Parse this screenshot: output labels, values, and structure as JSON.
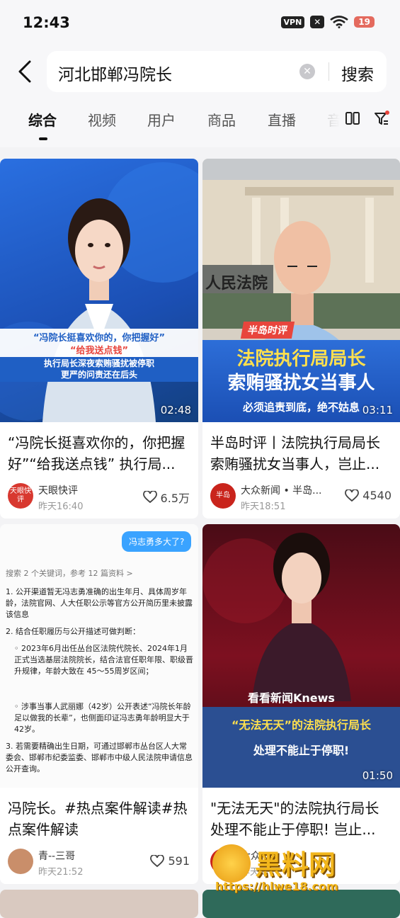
{
  "status_bar": {
    "time": "12:43",
    "vpn": "VPN",
    "battery": "19"
  },
  "search": {
    "query": "河北邯郸冯院长",
    "button": "搜索"
  },
  "tabs": [
    {
      "label": "综合",
      "active": true
    },
    {
      "label": "视频"
    },
    {
      "label": "用户"
    },
    {
      "label": "商品"
    },
    {
      "label": "直播"
    },
    {
      "label": "音"
    }
  ],
  "icons": {
    "back": "chevron-left-icon",
    "clear": "clear-icon",
    "layout": "grid-layout-icon",
    "filter": "filter-icon",
    "like": "heart-icon"
  },
  "colors": {
    "accent": "#e8453c",
    "news_blue": "#1f5fc4",
    "highlight_yellow": "#ffe04d"
  },
  "results": [
    {
      "duration": "02:48",
      "thumb_text": [
        "“冯院长挺喜欢你的，你把握好”",
        "“给我送点钱”",
        "执行局长深夜索贿骚扰被停职",
        "更严的问责还在后头"
      ],
      "title": "“冯院长挺喜欢你的，你把握好”“给我送点钱” 执行局...",
      "author": "天眼快评",
      "avatar_text": "天眼快评",
      "time": "昨天16:40",
      "likes": "6.5万"
    },
    {
      "duration": "03:11",
      "thumb_text": [
        "人民法院",
        "半岛时评",
        "法院执行局局长",
        "索贿骚扰女当事人",
        "必须追责到底，绝不姑息"
      ],
      "title": "半岛时评丨法院执行局局长索贿骚扰女当事人，岂止...",
      "author": "大众新闻 • 半岛...",
      "avatar_text": "半岛",
      "time": "昨天18:51",
      "likes": "4540"
    },
    {
      "thumb_text": [
        "冯志勇多大了?",
        "搜索 2 个关键词，参考 12 篇资料 >",
        "1. 公开渠道暂无冯志勇准确的出生年月、具体周岁年龄，法院官网、人大任职公示等官方公开简历里未披露该信息",
        "2. 结合任职履历与公开描述可做判断：",
        "◦ 2023年6月出任丛台区法院代院长、2024年1月正式当选基层法院院长，结合法官任职年限、职级晋升规律，年龄大致在 45～55周岁区间；",
        "◦ 涉事当事人武丽娜（42岁）公开表述“冯院长年龄足以做我的长辈”，也侧面印证冯志勇年龄明显大于42岁。",
        "3. 若需要精确出生日期，可通过邯郸市丛台区人大常委会、邯郸市纪委监委、邯郸市中级人民法院申请信息公开查询。"
      ],
      "title": "冯院长。#热点案件解读#热点案件解读",
      "author": "青--三哥",
      "time": "昨天21:52",
      "likes": "591"
    },
    {
      "duration": "01:50",
      "thumb_text": [
        "看看新闻Knews",
        "“无法无天”的法院执行局长",
        "处理不能止于停职!"
      ],
      "title": "\"无法无天\"的法院执行局长处理不能止于停职! 岂止...",
      "author": "大众...",
      "time": "昨天...",
      "likes": ""
    }
  ],
  "watermark": {
    "brand": "黑料网",
    "url": "https://hlwe18.com"
  }
}
